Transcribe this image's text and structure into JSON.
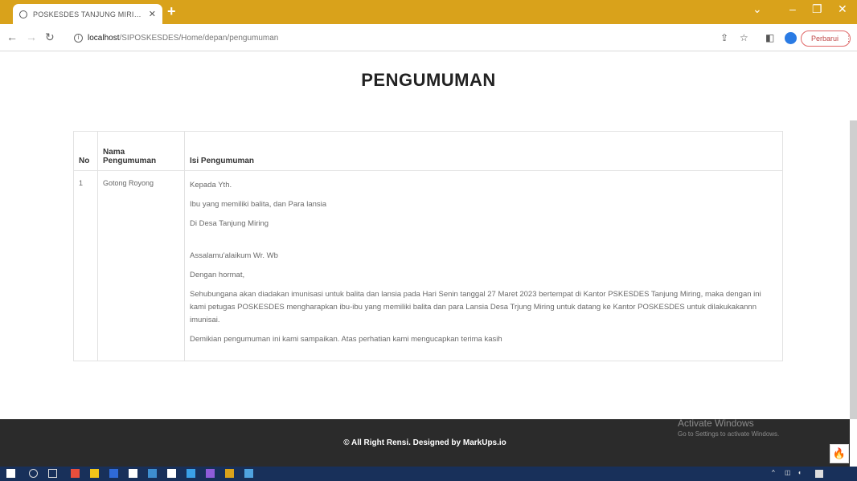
{
  "browser": {
    "tab_title": "POSKESDES TANJUNG MIRING",
    "new_tab": "+",
    "url_host": "localhost",
    "url_path": "/SIPOSKESDES/Home/depan/pengumuman",
    "update_label": "Perbarui"
  },
  "page": {
    "title": "PENGUMUMAN"
  },
  "table": {
    "headers": [
      "No",
      "Nama Pengumuman",
      "Isi Pengumuman"
    ],
    "rows": [
      {
        "no": "1",
        "name": "Gotong Royong",
        "content": [
          "Kepada Yth.",
          "Ibu yang memiliki balita, dan Para lansia",
          "Di Desa Tanjung Miring",
          "Assalamu'alaikum Wr. Wb",
          "Dengan hormat,",
          "Sehubungana akan diadakan imunisasi untuk balita dan lansia pada Hari Senin tanggal 27 Maret 2023 bertempat di Kantor PSKESDES Tanjung Miring, maka dengan ini kami petugas POSKESDES mengharapkan ibu-ibu yang memiliki balita dan para Lansia Desa Trjung Miring untuk datang ke Kantor POSKESDES untuk dilakukakannn imunisai.",
          "Demikian pengumuman ini kami sampaikan. Atas perhatian kami mengucapkan terima kasih"
        ]
      }
    ]
  },
  "footer": {
    "text": "© All Right Rensi. Designed by MarkUps.io"
  },
  "watermark": {
    "line1": "Activate Windows",
    "line2": "Go to Settings to activate Windows."
  },
  "colors": {
    "tabbar": "#d9a21b",
    "footer": "#2b2b2b",
    "taskbar": "#18305a"
  }
}
